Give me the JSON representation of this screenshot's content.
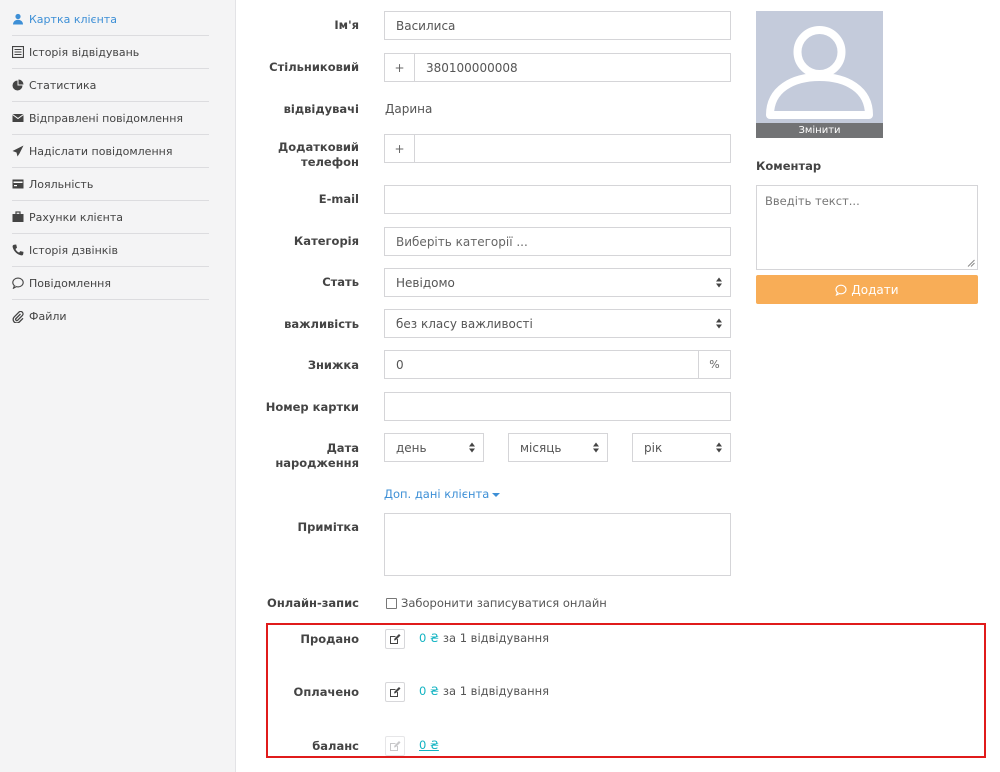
{
  "sidebar": {
    "items": [
      {
        "label": "Картка клієнта",
        "icon": "user-icon",
        "active": true
      },
      {
        "label": "Історія відвідувань",
        "icon": "list-icon"
      },
      {
        "label": "Статистика",
        "icon": "pie-chart-icon"
      },
      {
        "label": "Відправлені повідомлення",
        "icon": "envelope-icon"
      },
      {
        "label": "Надіслати повідомлення",
        "icon": "send-icon"
      },
      {
        "label": "Лояльність",
        "icon": "card-icon"
      },
      {
        "label": "Рахунки клієнта",
        "icon": "briefcase-icon"
      },
      {
        "label": "Історія дзвінків",
        "icon": "phone-icon"
      },
      {
        "label": "Повідомлення",
        "icon": "comment-icon"
      },
      {
        "label": "Файли",
        "icon": "paperclip-icon"
      }
    ],
    "accent": "#3d8fd6"
  },
  "form": {
    "name": {
      "label": "Ім'я",
      "value": "Василиса"
    },
    "phone": {
      "label": "Стільниковий",
      "prefix": "+",
      "value": "380100000008"
    },
    "visitors": {
      "label": "відвідувачі",
      "value": "Дарина"
    },
    "extra_phone": {
      "label_line1": "Додатковий",
      "label_line2": "телефон",
      "prefix": "+",
      "value": ""
    },
    "email": {
      "label": "E-mail",
      "value": ""
    },
    "category": {
      "label": "Категорія",
      "placeholder": "Виберіть категорії ..."
    },
    "gender": {
      "label": "Стать",
      "value": "Невідомо"
    },
    "importance": {
      "label": "важливість",
      "value": "без класу важливості"
    },
    "discount": {
      "label": "Знижка",
      "value": "0",
      "unit": "%"
    },
    "card_number": {
      "label": "Номер картки",
      "value": ""
    },
    "birthdate": {
      "label_line1": "Дата",
      "label_line2": "народження",
      "day": "день",
      "month": "місяць",
      "year": "рік"
    },
    "more_link": "Доп. дані клієнта",
    "note": {
      "label": "Примітка",
      "value": ""
    },
    "online": {
      "label": "Онлайн-запис",
      "checkbox_label": "Заборонити записуватися онлайн",
      "checked": false
    }
  },
  "avatar": {
    "icon": "user-silhouette-icon",
    "change_label": "Змінити"
  },
  "comment": {
    "label": "Коментар",
    "placeholder": "Введіть текст...",
    "add_label": "Додати",
    "add_color": "#f8ad57"
  },
  "finance": {
    "sold": {
      "label": "Продано",
      "amount": "0 ₴",
      "suffix": "за 1 відвідування"
    },
    "paid": {
      "label": "Оплачено",
      "amount": "0 ₴",
      "suffix": "за 1 відвідування"
    },
    "balance": {
      "label": "баланс",
      "amount": "0 ₴"
    },
    "highlight_color": "#e01b1b"
  }
}
